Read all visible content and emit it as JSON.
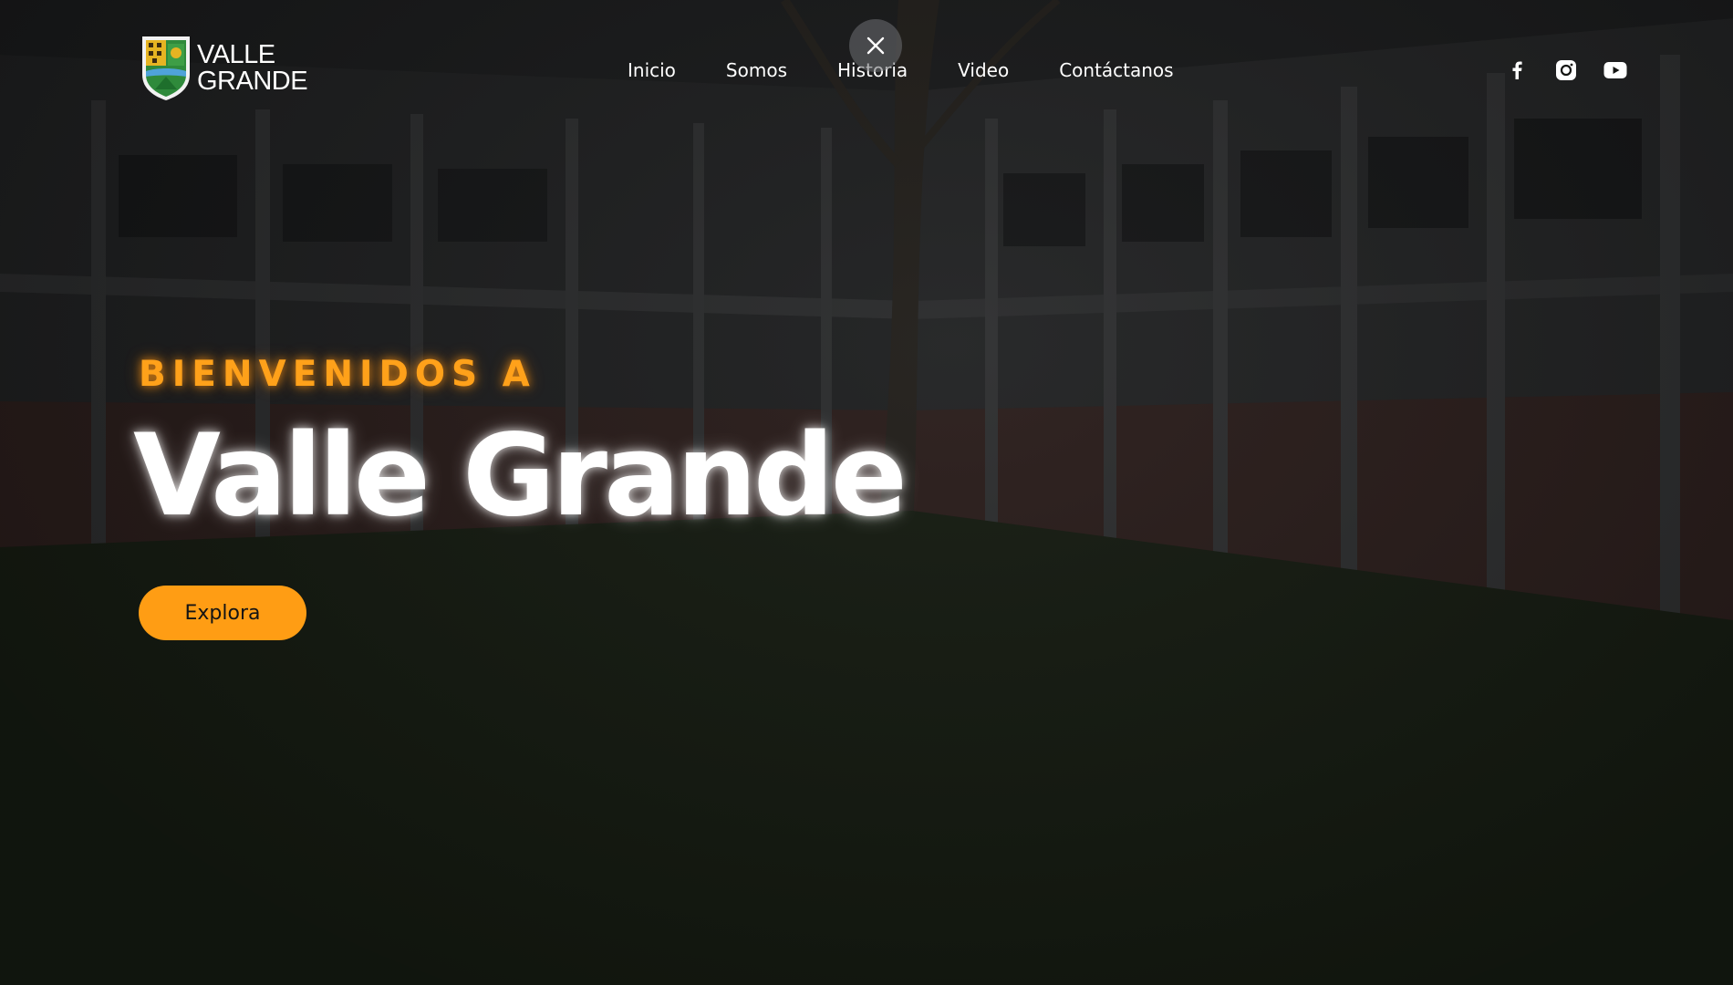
{
  "brand": {
    "name_line1": "VALLE",
    "name_line2": "GRANDE"
  },
  "nav": {
    "items": [
      {
        "label": "Inicio"
      },
      {
        "label": "Somos"
      },
      {
        "label": "Historia"
      },
      {
        "label": "Video"
      },
      {
        "label": "Contáctanos"
      }
    ]
  },
  "social": {
    "icons": [
      "facebook-icon",
      "instagram-icon",
      "youtube-icon"
    ]
  },
  "hero": {
    "eyebrow": "BIENVENIDOS A",
    "title": "Valle Grande",
    "cta_label": "Explora"
  },
  "colors": {
    "accent": "#ff9d14",
    "background": "#141513",
    "text": "#ffffff"
  }
}
